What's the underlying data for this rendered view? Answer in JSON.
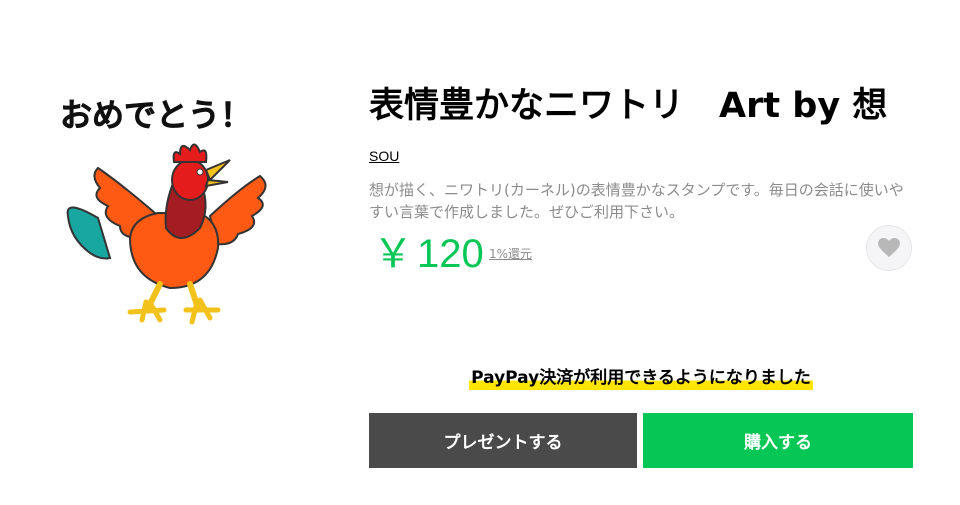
{
  "sticker": {
    "caption": "おめでとう！",
    "alt": "rooster-sticker-image"
  },
  "product": {
    "title": "表情豊かなニワトリ　Art by 想",
    "author": "SOU",
    "description": "想が描く、ニワトリ(カーネル)の表情豊かなスタンプです。毎日の会話に使いやすい言葉で作成しました。ぜひご利用下さい。",
    "price_symbol": "￥",
    "price_value": "120",
    "reward": "1%還元"
  },
  "favorite": {
    "icon": "heart-icon"
  },
  "notice": {
    "paypay": "PayPay決済が利用できるようになりました"
  },
  "buttons": {
    "gift_label": "プレゼントする",
    "buy_label": "購入する"
  },
  "colors": {
    "accent_green": "#06c755",
    "gift_gray": "#4a4a4a",
    "highlight_yellow": "#ffe500",
    "muted_text": "#8c8c8c"
  }
}
